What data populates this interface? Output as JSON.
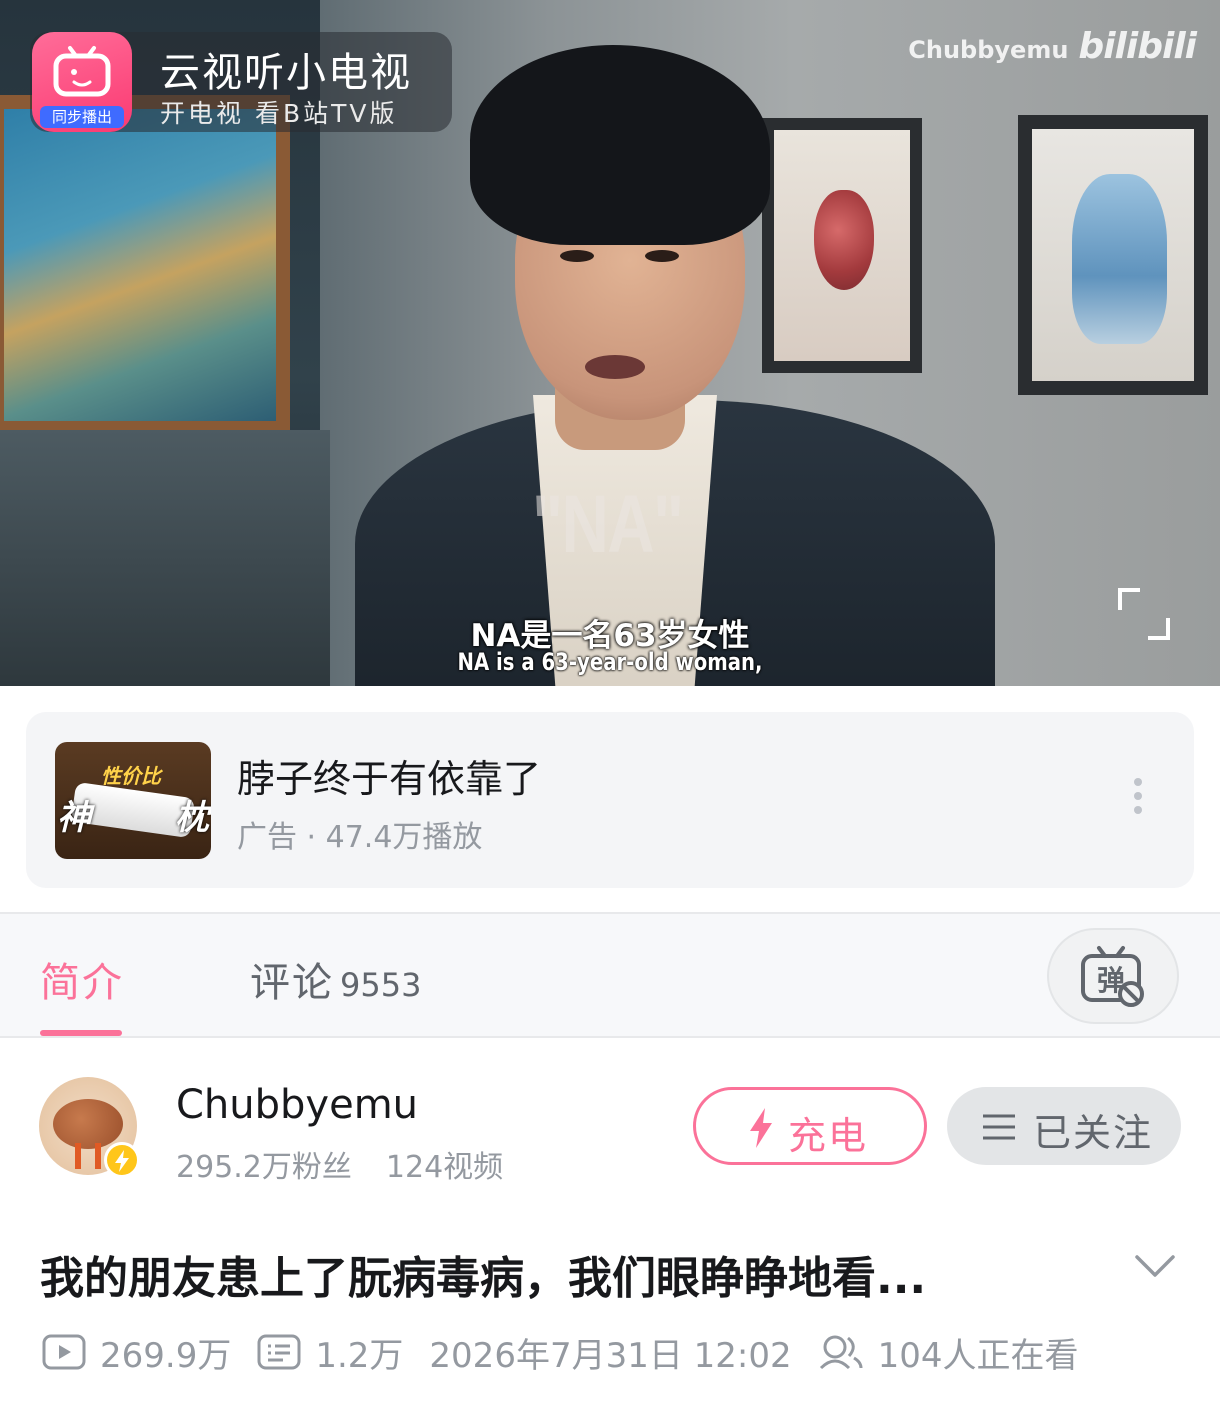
{
  "player": {
    "ad_badge": {
      "app_icon_label": "同步播出",
      "title": "云视听小电视",
      "subtitle": "开电视 看B站TV版"
    },
    "channel_watermark": "Chubbyemu",
    "site_logo": "bilibili",
    "on_screen_text": "\"NA\"",
    "subtitle_cn": "NA是一名63岁女性",
    "subtitle_en": "NA is a 63-year-old woman,"
  },
  "ad_card": {
    "thumb_text": {
      "top": "性价比",
      "left": "神",
      "right": "枕"
    },
    "title": "脖子终于有依靠了",
    "meta": "广告 · 47.4万播放"
  },
  "tabs": {
    "intro": "简介",
    "comments_label": "评论",
    "comments_count": "9553",
    "danmaku_glyph": "弹"
  },
  "uploader": {
    "name": "Chubbyemu",
    "followers": "295.2万粉丝",
    "videos": "124视频",
    "charge_label": "充电",
    "follow_label": "已关注"
  },
  "video": {
    "title": "我的朋友患上了朊病毒病，我们眼睁睁地看...",
    "views": "269.9万",
    "danmaku_count": "1.2万",
    "publish_time": "2026年7月31日 12:02",
    "watching_now": "104人正在看"
  },
  "colors": {
    "accent_pink": "#fb7299",
    "text_primary": "#18191c",
    "text_secondary": "#9499a0",
    "badge_yellow": "#ffc61a"
  }
}
